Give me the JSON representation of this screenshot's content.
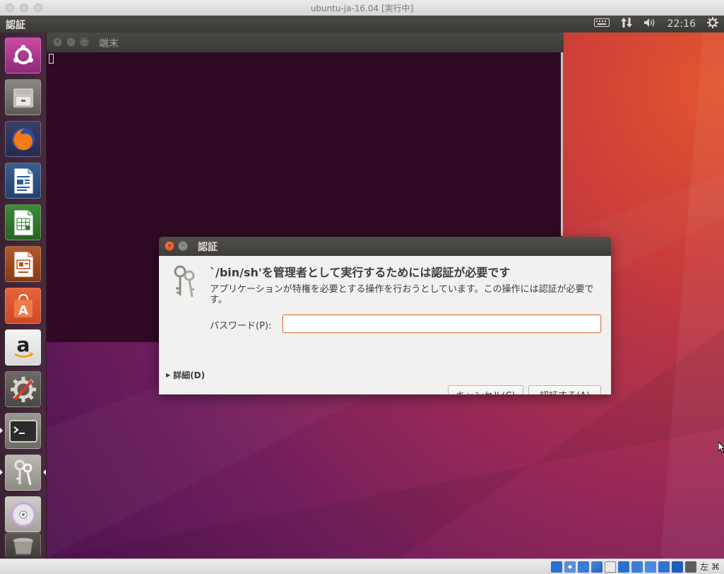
{
  "host_window": {
    "title": "ubuntu-ja-16.04 [実行中]"
  },
  "top_panel": {
    "app_title": "認証",
    "clock": "22:16",
    "indicators": [
      "keyboard-icon",
      "network-icon",
      "volume-icon",
      "gear-icon"
    ]
  },
  "launcher": {
    "items": [
      {
        "name": "ubuntu-dash",
        "icon": "ubuntu-logo-icon"
      },
      {
        "name": "files",
        "icon": "file-cabinet-icon"
      },
      {
        "name": "firefox",
        "icon": "firefox-icon"
      },
      {
        "name": "libreoffice-writer",
        "icon": "writer-doc-icon"
      },
      {
        "name": "libreoffice-calc",
        "icon": "calc-sheet-icon"
      },
      {
        "name": "libreoffice-impress",
        "icon": "impress-slide-icon"
      },
      {
        "name": "ubuntu-software",
        "icon": "software-bag-icon"
      },
      {
        "name": "amazon",
        "icon": "amazon-icon"
      },
      {
        "name": "system-settings",
        "icon": "settings-wrench-icon"
      },
      {
        "name": "terminal",
        "icon": "terminal-icon"
      },
      {
        "name": "authentication",
        "icon": "keys-icon"
      },
      {
        "name": "dvd",
        "icon": "dvd-icon"
      },
      {
        "name": "trash",
        "icon": "trash-icon"
      }
    ]
  },
  "terminal": {
    "title": "端末"
  },
  "auth_dialog": {
    "title": "認証",
    "heading": "`/bin/sh'を管理者として実行するためには認証が必要です",
    "description": "アプリケーションが特権を必要とする操作を行おうとしています。この操作には認証が必要です。",
    "password_label": "パスワード(P):",
    "password_value": "",
    "details_label": "詳細(D)",
    "cancel_label": "キャンセル(C)",
    "authenticate_label": "認証する(A)"
  },
  "status_bar": {
    "host_key": "左 ⌘"
  },
  "colors": {
    "terminal_bg": "#300a24",
    "accent_orange": "#e07a53",
    "close_button": "#df4a23"
  }
}
